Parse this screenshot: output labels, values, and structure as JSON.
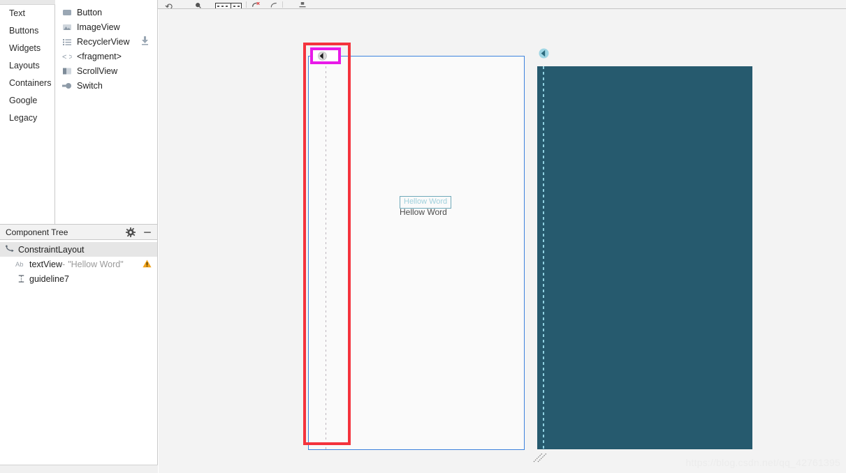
{
  "toolbar": {
    "items": [
      {
        "name": "undo-icon",
        "glyph": "↶"
      },
      {
        "name": "zoom-icon",
        "glyph": "⌕"
      },
      {
        "name": "device-size-icon",
        "glyph": ""
      },
      {
        "name": "clear-constraints-icon",
        "glyph": "↪"
      },
      {
        "name": "autoconnect-icon",
        "glyph": "↗"
      },
      {
        "name": "align-icon",
        "glyph": "⤓"
      }
    ]
  },
  "palette": {
    "categories": [
      {
        "label": "Text",
        "name": "palette-category-text"
      },
      {
        "label": "Buttons",
        "name": "palette-category-buttons"
      },
      {
        "label": "Widgets",
        "name": "palette-category-widgets"
      },
      {
        "label": "Layouts",
        "name": "palette-category-layouts"
      },
      {
        "label": "Containers",
        "name": "palette-category-containers"
      },
      {
        "label": "Google",
        "name": "palette-category-google"
      },
      {
        "label": "Legacy",
        "name": "palette-category-legacy"
      }
    ],
    "items": [
      {
        "label": "Button",
        "icon": "button-icon",
        "download": false
      },
      {
        "label": "ImageView",
        "icon": "imageview-icon",
        "download": false
      },
      {
        "label": "RecyclerView",
        "icon": "recyclerview-icon",
        "download": true,
        "download_icon": "download-icon"
      },
      {
        "label": "<fragment>",
        "icon": "fragment-icon",
        "download": false
      },
      {
        "label": "ScrollView",
        "icon": "scrollview-icon",
        "download": false
      },
      {
        "label": "Switch",
        "icon": "switch-icon",
        "download": false
      }
    ]
  },
  "component_tree": {
    "title": "Component Tree",
    "header_icons": [
      {
        "name": "gear-icon",
        "glyph": "⚙"
      },
      {
        "name": "minimize-icon",
        "glyph": "—"
      }
    ],
    "nodes": [
      {
        "label": "ConstraintLayout",
        "icon": "constraintlayout-icon",
        "indent": 0,
        "selected": true,
        "warning": false,
        "suffix": "",
        "suffix_value": ""
      },
      {
        "label": "textView",
        "icon": "textview-icon",
        "indent": 1,
        "selected": false,
        "warning": true,
        "warning_icon": "warning-icon",
        "suffix": "-",
        "suffix_value": "\"Hellow Word\""
      },
      {
        "label": "guideline7",
        "icon": "guideline-icon",
        "indent": 1,
        "selected": false,
        "warning": false,
        "suffix": "",
        "suffix_value": ""
      }
    ]
  },
  "canvas": {
    "design_preview": {
      "name": "design-surface-preview",
      "text": "Hellow Word",
      "border_color": "#3d82dd",
      "background_color": "#fafafa"
    },
    "blueprint_preview": {
      "name": "blueprint-surface-preview",
      "text": "Hellow Word",
      "background_color": "#265a6e",
      "accent_color": "#8fd0e0"
    },
    "guideline": {
      "name": "vertical-guideline",
      "handle_icon": "guideline-orientation-handle-icon"
    },
    "annotations": {
      "red_box_color": "#f4333d",
      "magenta_box_color": "#e81ae8"
    }
  },
  "watermark": {
    "text": "https://blog.csdn.net/qq_42761395"
  }
}
